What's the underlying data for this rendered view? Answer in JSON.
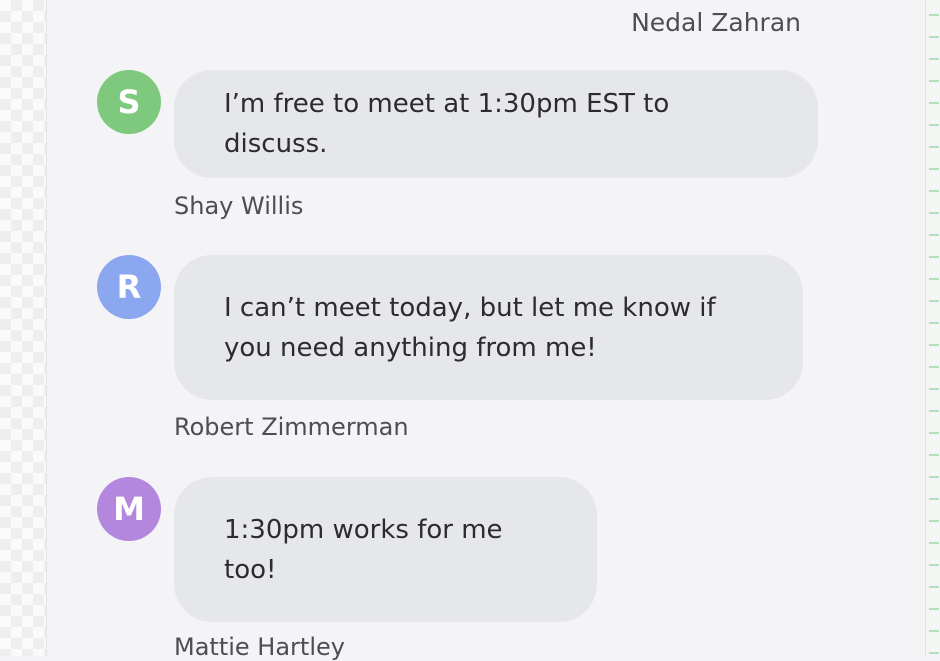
{
  "chat": {
    "top_sender": "Nedal Zahran",
    "messages": [
      {
        "avatar_initial": "S",
        "avatar_color": "#7ec97d",
        "text": "I’m free to meet at 1:30pm EST to discuss.",
        "sender": "Shay Willis"
      },
      {
        "avatar_initial": "R",
        "avatar_color": "#8aa7f0",
        "text": "I can’t meet today, but let me know if you need anything from me!",
        "sender": "Robert Zimmerman"
      },
      {
        "avatar_initial": "M",
        "avatar_color": "#b387dd",
        "text": "1:30pm works for me too!",
        "sender": "Mattie Hartley"
      }
    ]
  }
}
